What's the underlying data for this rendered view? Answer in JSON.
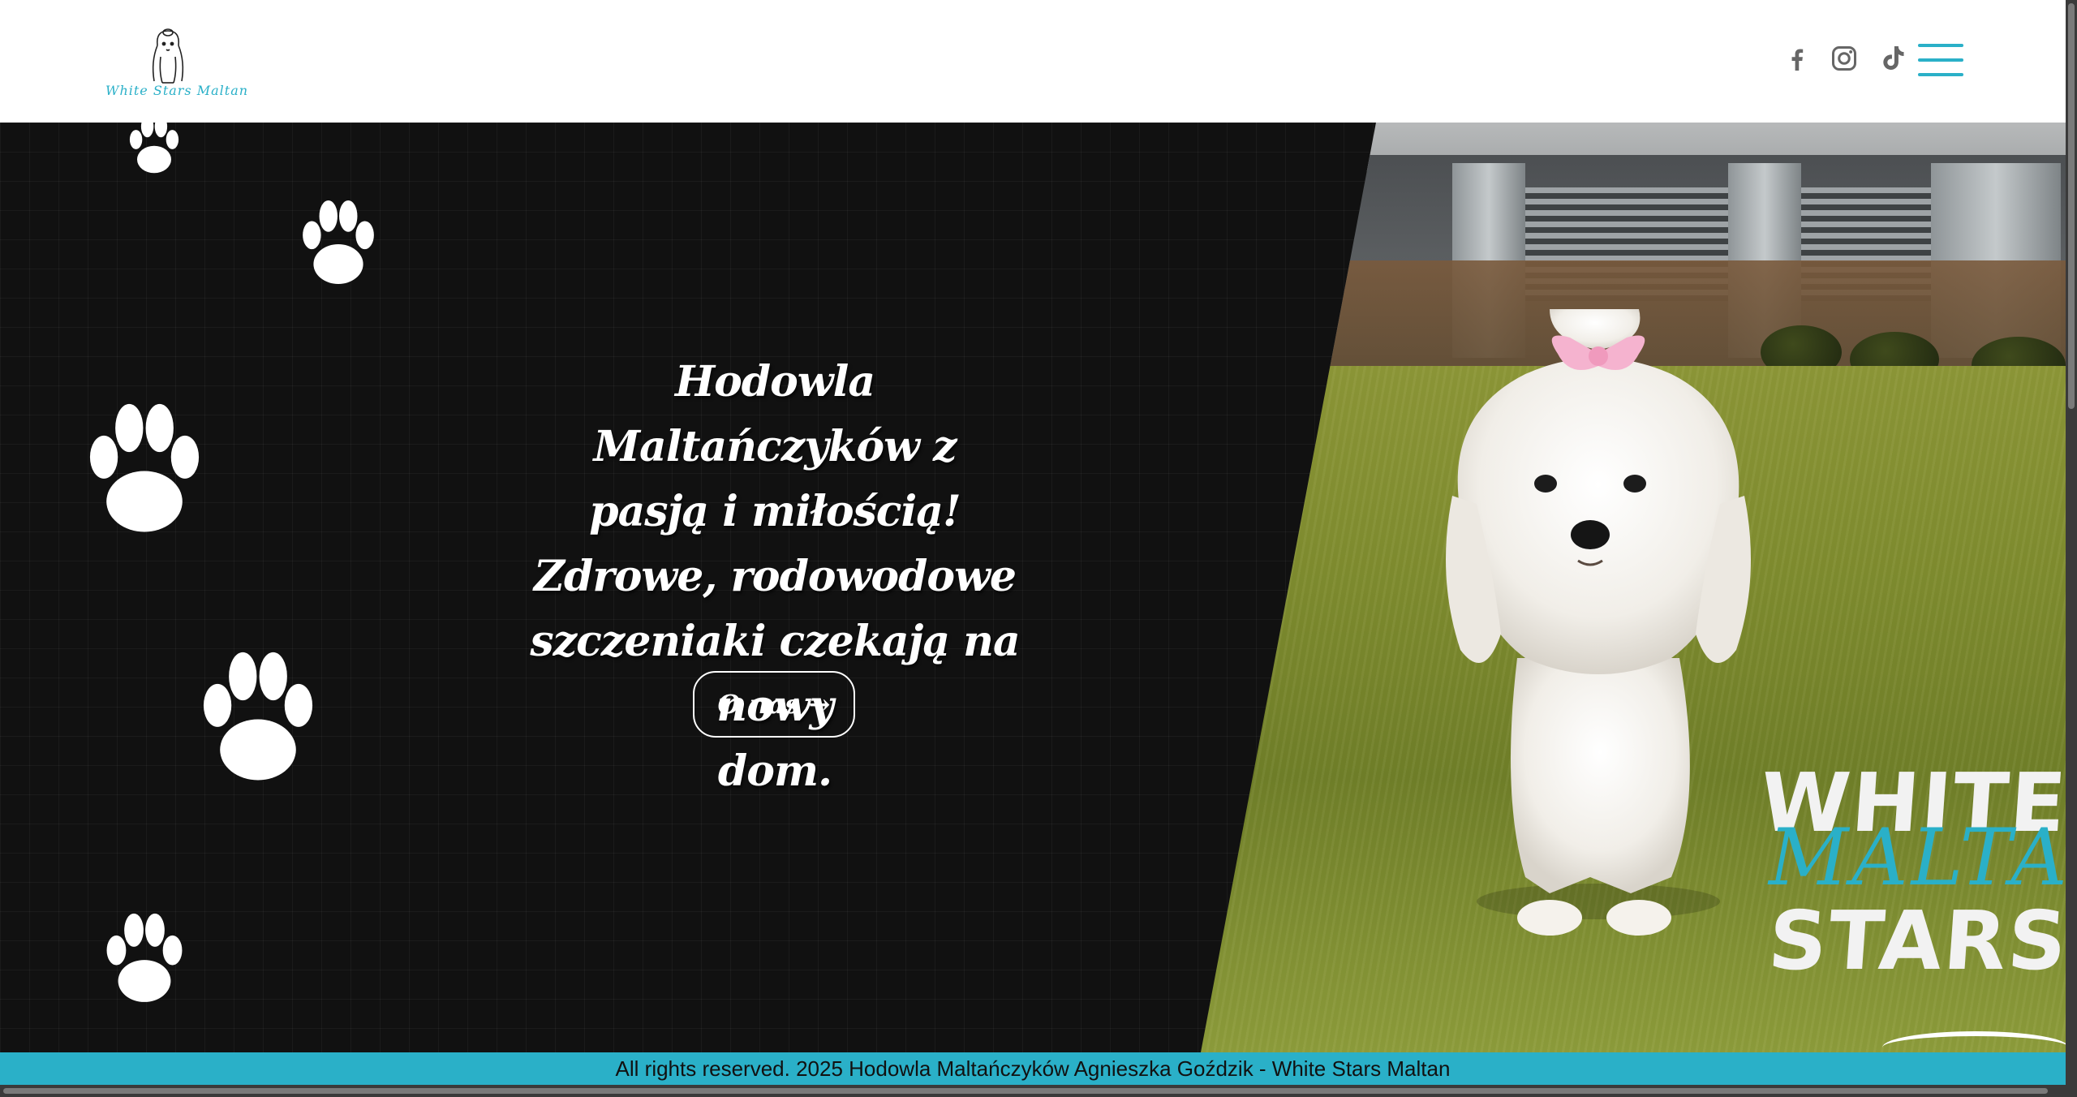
{
  "header": {
    "logo_text": "White Stars Maltan",
    "social": [
      {
        "name": "facebook-icon"
      },
      {
        "name": "instagram-icon"
      },
      {
        "name": "tiktok-icon"
      }
    ],
    "menu_icon": "hamburger-menu-icon"
  },
  "hero": {
    "title_lines": [
      "Hodowla Maltańczyków z",
      "pasją i miłością!",
      "Zdrowe, rodowodowe",
      "szczeniaki czekają na nowy",
      "dom."
    ],
    "button_label": "O nas →",
    "watermark": {
      "top": "WHITE",
      "middle": "MALTAN",
      "bottom": "STARS"
    }
  },
  "footer": {
    "text": "All rights reserved. 2025 Hodowla Maltańczyków Agnieszka Goździk - White Stars Maltan"
  },
  "colors": {
    "accent": "#2ab0c8",
    "hero_bg": "#111111",
    "header_bg": "#ffffff",
    "icon_gray": "#666666"
  }
}
